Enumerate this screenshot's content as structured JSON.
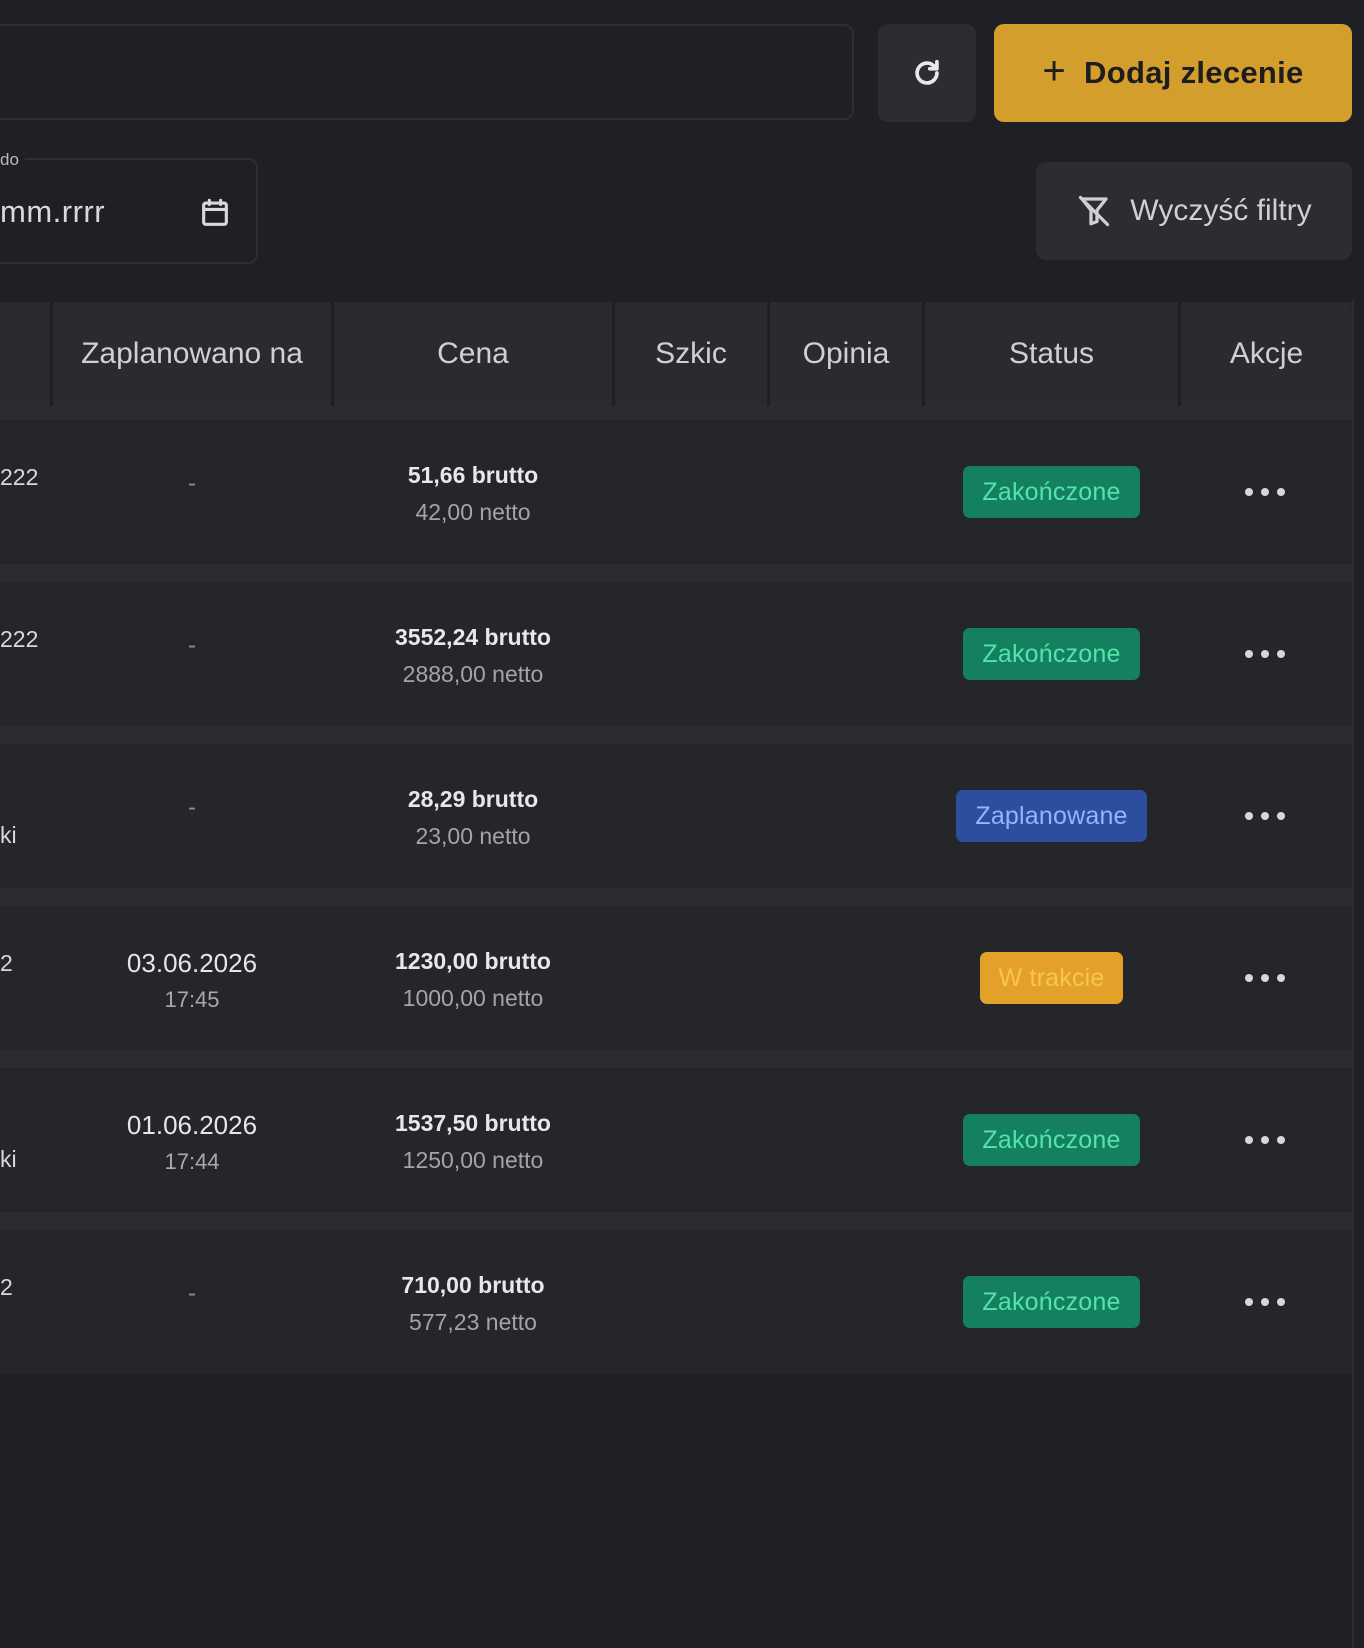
{
  "toolbar": {
    "add_label": "Dodaj zlecenie",
    "add_icon": "plus-icon",
    "refresh_icon": "refresh-icon",
    "accent_color": "#d39e2c"
  },
  "filters": {
    "date_to_legend": "do",
    "date_to_value": "mm.rrrr",
    "calendar_icon": "calendar-icon",
    "clear_label": "Wyczyść filtry",
    "clear_icon": "filter-off-icon"
  },
  "table": {
    "columns": [
      "Zaplanowano na",
      "Cena",
      "Szkic",
      "Opinia",
      "Status",
      "Akcje"
    ],
    "rows": [
      {
        "frag": "222",
        "frag2": "",
        "scheduled_date": "-",
        "scheduled_time": "",
        "brutto": "51,66 brutto",
        "netto": "42,00 netto",
        "status": "Zakończone",
        "status_kind": "green"
      },
      {
        "frag": "222",
        "frag2": "",
        "scheduled_date": "-",
        "scheduled_time": "",
        "brutto": "3552,24 brutto",
        "netto": "2888,00 netto",
        "status": "Zakończone",
        "status_kind": "green"
      },
      {
        "frag": "",
        "frag2": "ki",
        "scheduled_date": "-",
        "scheduled_time": "",
        "brutto": "28,29 brutto",
        "netto": "23,00 netto",
        "status": "Zaplanowane",
        "status_kind": "blue"
      },
      {
        "frag": "2",
        "frag2": "",
        "scheduled_date": "03.06.2026",
        "scheduled_time": "17:45",
        "brutto": "1230,00 brutto",
        "netto": "1000,00 netto",
        "status": "W trakcie",
        "status_kind": "amber"
      },
      {
        "frag": "",
        "frag2": "ki",
        "scheduled_date": "01.06.2026",
        "scheduled_time": "17:44",
        "brutto": "1537,50 brutto",
        "netto": "1250,00 netto",
        "status": "Zakończone",
        "status_kind": "green"
      },
      {
        "frag": "2",
        "frag2": "",
        "scheduled_date": "-",
        "scheduled_time": "",
        "brutto": "710,00 brutto",
        "netto": "577,23 netto",
        "status": "Zakończone",
        "status_kind": "green"
      }
    ],
    "actions_icon": "more-horizontal-icon"
  },
  "colors": {
    "status_green": "#15805f",
    "status_blue": "#2c4e9c",
    "status_amber": "#e4a12a"
  }
}
